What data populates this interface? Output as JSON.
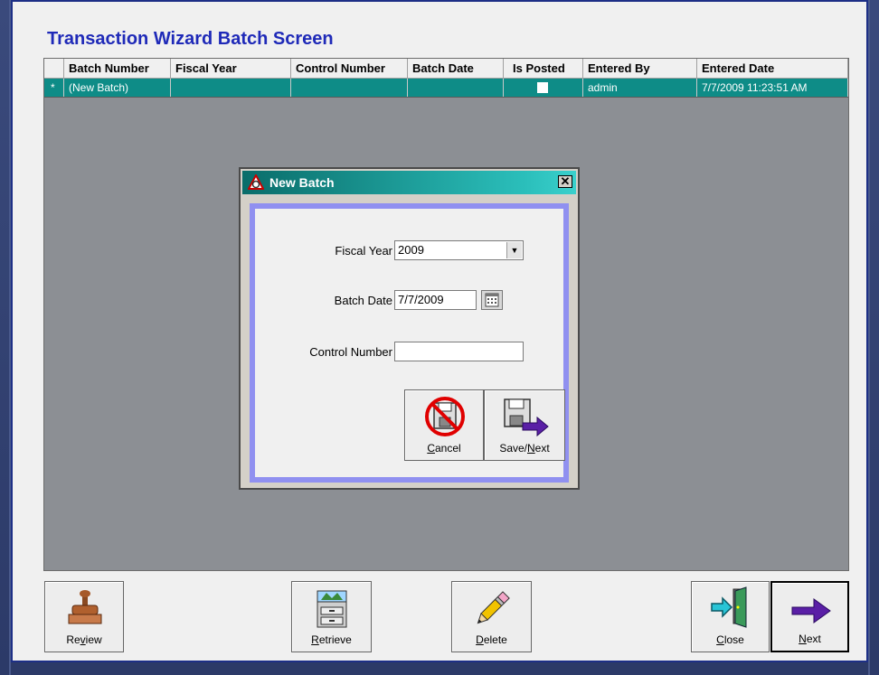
{
  "screen": {
    "title": "Transaction Wizard Batch Screen"
  },
  "grid": {
    "columns": [
      "",
      "Batch Number",
      "Fiscal Year",
      "Control Number",
      "Batch Date",
      "Is Posted",
      "Entered By",
      "Entered Date"
    ],
    "row": {
      "marker": "*",
      "batch_number": "(New Batch)",
      "fiscal_year": "",
      "control_number": "",
      "batch_date": "",
      "is_posted": false,
      "entered_by": "admin",
      "entered_date": "7/7/2009 11:23:51 AM"
    }
  },
  "dialog": {
    "title": "New Batch",
    "close_label": "✕",
    "fiscal_year_label": "Fiscal Year",
    "fiscal_year_value": "2009",
    "batch_date_label": "Batch Date",
    "batch_date_value": "7/7/2009",
    "control_number_label": "Control Number",
    "control_number_value": "",
    "cancel_label_pre": "",
    "cancel_label_u": "C",
    "cancel_label_post": "ancel",
    "save_label_pre": "Save/",
    "save_label_u": "N",
    "save_label_post": "ext"
  },
  "toolbar": {
    "review": {
      "pre": "Re",
      "u": "v",
      "post": "iew"
    },
    "retrieve": {
      "pre": "",
      "u": "R",
      "post": "etrieve"
    },
    "delete": {
      "pre": "",
      "u": "D",
      "post": "elete"
    },
    "close": {
      "pre": "",
      "u": "C",
      "post": "lose"
    },
    "next": {
      "pre": "",
      "u": "N",
      "post": "ext"
    }
  },
  "colors": {
    "accent_teal": "#0e8c87",
    "title_blue": "#1f2ab8",
    "grid_bg": "#8c8f94",
    "dialog_border": "#9090f0"
  },
  "icons": [
    "review-stamp-icon",
    "retrieve-cabinet-icon",
    "delete-pencil-icon",
    "close-door-icon",
    "next-arrow-icon",
    "cancel-disk-icon",
    "save-next-disk-icon",
    "calendar-icon",
    "dropdown-arrow-icon"
  ]
}
